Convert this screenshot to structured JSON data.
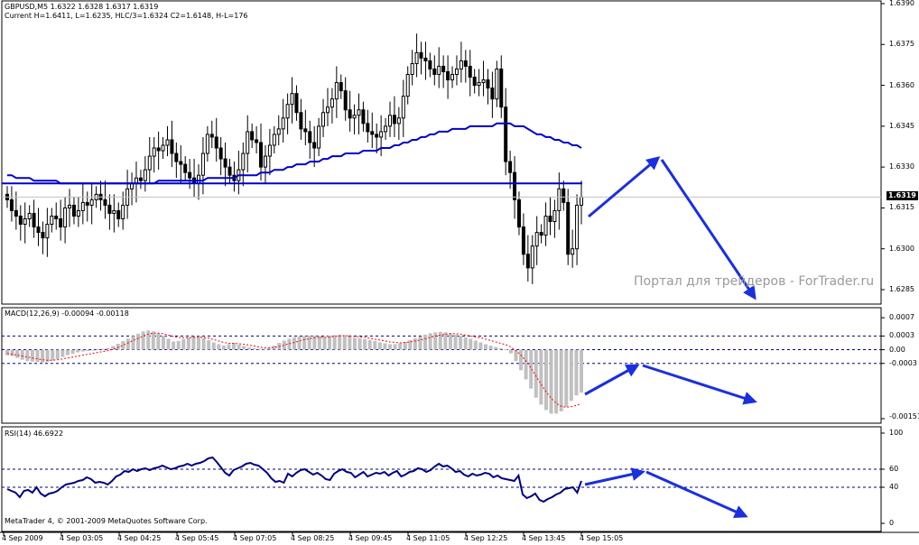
{
  "main_header": {
    "symbol_line": "GBPUSD,M5  1.6322 1.6328 1.6317 1.6319",
    "current_line": "Current H=1.6411, L=1.6235, HLC/3=1.6324 C2=1.6148, H-L=176"
  },
  "macd_header": "MACD(12,26,9) -0.00094 -0.00118",
  "rsi_header": "RSI(14) 46.6922",
  "copyright": "MetaTrader 4, © 2001-2009 MetaQuotes Software Corp.",
  "watermark": "Портал для трейдеров - ForTrader.ru",
  "current_price_tag": "1.6319",
  "price_axis_labels": [
    "1.6390",
    "1.6375",
    "1.6360",
    "1.6345",
    "1.6330",
    "1.6315",
    "1.6300",
    "1.6285"
  ],
  "macd_axis_labels": [
    "0.0007",
    "0.0003",
    "0.00",
    "-0.0003",
    "-0.00151"
  ],
  "rsi_axis_labels": [
    "100",
    "60",
    "40",
    "0"
  ],
  "time_axis_labels": [
    "4 Sep 2009",
    "4 Sep 03:05",
    "4 Sep 04:25",
    "4 Sep 05:45",
    "4 Sep 07:05",
    "4 Sep 08:25",
    "4 Sep 09:45",
    "4 Sep 11:05",
    "4 Sep 12:25",
    "4 Sep 13:45",
    "4 Sep 15:05"
  ],
  "colors": {
    "bull_candle": "#000000",
    "bear_candle": "#000000",
    "moving_average": "#0000cc",
    "horizontal_level": "#0000cc",
    "forecast_arrows": "#1a2fe0",
    "macd_histogram": "#c0c0c0",
    "macd_signal": "#ff0000",
    "rsi_line": "#000080",
    "level_lines": "#000080"
  },
  "chart_data": [
    {
      "type": "candlestick",
      "title": "GBPUSD,M5",
      "ylim": [
        1.6285,
        1.639
      ],
      "horizontal_level": 1.6324,
      "current_price": 1.6319,
      "closes": [
        1.6318,
        1.6314,
        1.6312,
        1.6309,
        1.6311,
        1.6313,
        1.6308,
        1.6306,
        1.6304,
        1.6309,
        1.6312,
        1.6311,
        1.6308,
        1.6315,
        1.6316,
        1.6312,
        1.6314,
        1.6317,
        1.6316,
        1.6318,
        1.632,
        1.6318,
        1.6316,
        1.6313,
        1.6314,
        1.6311,
        1.6316,
        1.6322,
        1.6324,
        1.6326,
        1.6325,
        1.6329,
        1.6334,
        1.6337,
        1.6336,
        1.6338,
        1.634,
        1.6335,
        1.6332,
        1.6331,
        1.6328,
        1.6326,
        1.6324,
        1.6327,
        1.6335,
        1.6342,
        1.6341,
        1.6337,
        1.6333,
        1.633,
        1.6327,
        1.6325,
        1.6329,
        1.6335,
        1.6343,
        1.634,
        1.6339,
        1.633,
        1.6334,
        1.6338,
        1.6342,
        1.6344,
        1.6348,
        1.6353,
        1.6357,
        1.635,
        1.6344,
        1.6343,
        1.6339,
        1.6337,
        1.6345,
        1.635,
        1.6352,
        1.6355,
        1.6361,
        1.6358,
        1.6351,
        1.6348,
        1.6349,
        1.6351,
        1.6346,
        1.6343,
        1.6342,
        1.6341,
        1.6343,
        1.6345,
        1.6349,
        1.6346,
        1.6348,
        1.6356,
        1.6364,
        1.6368,
        1.6372,
        1.637,
        1.6369,
        1.6366,
        1.6364,
        1.6367,
        1.6365,
        1.6362,
        1.6364,
        1.6366,
        1.6369,
        1.6367,
        1.6363,
        1.636,
        1.6361,
        1.6362,
        1.6359,
        1.6355,
        1.6366,
        1.6352,
        1.6332,
        1.6328,
        1.6318,
        1.6308,
        1.6298,
        1.6293,
        1.6301,
        1.6306,
        1.6305,
        1.6312,
        1.631,
        1.6314,
        1.6322,
        1.6317,
        1.6298,
        1.63,
        1.6316,
        1.6319
      ],
      "series": [
        {
          "name": "MA",
          "values": [
            1.6327,
            1.6327,
            1.6326,
            1.6326,
            1.6326,
            1.6326,
            1.6325,
            1.6325,
            1.6325,
            1.6325,
            1.6325,
            1.6325,
            1.6324,
            1.6324,
            1.6324,
            1.6324,
            1.6324,
            1.6324,
            1.6324,
            1.6324,
            1.6324,
            1.6324,
            1.6324,
            1.6324,
            1.6324,
            1.6324,
            1.6324,
            1.6324,
            1.6324,
            1.6324,
            1.6324,
            1.6324,
            1.6324,
            1.6324,
            1.6325,
            1.6325,
            1.6325,
            1.6325,
            1.6325,
            1.6325,
            1.6325,
            1.6325,
            1.6325,
            1.6325,
            1.6325,
            1.6326,
            1.6326,
            1.6326,
            1.6326,
            1.6326,
            1.6326,
            1.6326,
            1.6327,
            1.6327,
            1.6327,
            1.6327,
            1.6327,
            1.6328,
            1.6328,
            1.6328,
            1.6329,
            1.6329,
            1.6329,
            1.633,
            1.633,
            1.6331,
            1.6331,
            1.6331,
            1.6332,
            1.6332,
            1.6332,
            1.6333,
            1.6333,
            1.6334,
            1.6334,
            1.6334,
            1.6335,
            1.6335,
            1.6335,
            1.6335,
            1.6336,
            1.6336,
            1.6336,
            1.6336,
            1.6337,
            1.6337,
            1.6337,
            1.6338,
            1.6338,
            1.6339,
            1.6339,
            1.634,
            1.634,
            1.6341,
            1.6341,
            1.6342,
            1.6342,
            1.6343,
            1.6343,
            1.6343,
            1.6344,
            1.6344,
            1.6344,
            1.6344,
            1.6345,
            1.6345,
            1.6345,
            1.6345,
            1.6345,
            1.6345,
            1.6346,
            1.6346,
            1.6346,
            1.6346,
            1.6345,
            1.6345,
            1.6345,
            1.6344,
            1.6343,
            1.6342,
            1.6342,
            1.6341,
            1.6341,
            1.634,
            1.634,
            1.6339,
            1.6339,
            1.6338,
            1.6338,
            1.6337
          ]
        }
      ]
    },
    {
      "type": "bar",
      "title": "MACD(12,26,9)",
      "ylim": [
        -0.00151,
        0.0009
      ],
      "levels": [
        0.0003,
        0.0,
        -0.0003
      ],
      "series": [
        {
          "name": "MACD",
          "values": [
            -0.00012,
            -0.00014,
            -0.00018,
            -0.00022,
            -0.00025,
            -0.00026,
            -0.00027,
            -0.00028,
            -0.00027,
            -0.00024,
            -0.00021,
            -0.00016,
            -0.00012,
            -9e-05,
            -6e-05,
            -4e-05,
            -3e-05,
            -1e-05,
            1e-05,
            2e-05,
            4e-05,
            8e-05,
            0.00013,
            0.00019,
            0.00024,
            0.0003,
            0.00035,
            0.0004,
            0.00042,
            0.0004,
            0.00036,
            0.00031,
            0.00024,
            0.00018,
            0.00019,
            0.00023,
            0.00027,
            0.00029,
            0.0003,
            0.00026,
            0.00021,
            0.00016,
            0.00012,
            9e-05,
            0.00012,
            0.00015,
            0.00011,
            8e-05,
            5e-05,
            3e-05,
            2e-05,
            2e-05,
            4e-05,
            9e-05,
            0.00015,
            0.0002,
            0.00024,
            0.00027,
            0.00029,
            0.0003,
            0.00031,
            0.00031,
            0.0003,
            0.00028,
            0.00031,
            0.00032,
            0.00033,
            0.00032,
            0.00029,
            0.00026,
            0.00025,
            0.00023,
            0.00021,
            0.00019,
            0.00016,
            0.00014,
            0.00012,
            0.00012,
            0.00014,
            0.00017,
            0.00021,
            0.00025,
            0.00029,
            0.00033,
            0.00036,
            0.00038,
            0.00039,
            0.00038,
            0.00036,
            0.00033,
            0.0003,
            0.00027,
            0.00024,
            0.0002,
            0.00016,
            0.00012,
            9e-05,
            6e-05,
            3e-05,
            1e-05,
            -8e-05,
            -0.00025,
            -0.00045,
            -0.00065,
            -0.00085,
            -0.00105,
            -0.0012,
            -0.00132,
            -0.0014,
            -0.0014,
            -0.00135,
            -0.00125,
            -0.00112,
            -0.001,
            -0.00094
          ]
        },
        {
          "name": "Signal",
          "values": [
            -8e-05,
            -0.0001,
            -0.00012,
            -0.00014,
            -0.00016,
            -0.00018,
            -0.0002,
            -0.00022,
            -0.00023,
            -0.00023,
            -0.00022,
            -0.0002,
            -0.00018,
            -0.00016,
            -0.00014,
            -0.00012,
            -0.0001,
            -8e-05,
            -6e-05,
            -4e-05,
            -2e-05,
            1e-05,
            5e-05,
            0.0001,
            0.00015,
            0.0002,
            0.00025,
            0.0003,
            0.00034,
            0.00036,
            0.00036,
            0.00035,
            0.00032,
            0.00029,
            0.00027,
            0.00026,
            0.00026,
            0.00027,
            0.00028,
            0.00027,
            0.00025,
            0.00022,
            0.00019,
            0.00016,
            0.00014,
            0.00014,
            0.00013,
            0.00012,
            0.0001,
            8e-05,
            6e-05,
            4e-05,
            4e-05,
            5e-05,
            7e-05,
            0.0001,
            0.00013,
            0.00016,
            0.00019,
            0.00022,
            0.00024,
            0.00026,
            0.00027,
            0.00027,
            0.00028,
            0.00029,
            0.0003,
            0.00031,
            0.0003,
            0.00029,
            0.00028,
            0.00027,
            0.00025,
            0.00023,
            0.00021,
            0.00019,
            0.00017,
            0.00016,
            0.00015,
            0.00016,
            0.00017,
            0.00019,
            0.00021,
            0.00024,
            0.00027,
            0.0003,
            0.00032,
            0.00034,
            0.00035,
            0.00035,
            0.00034,
            0.00032,
            0.0003,
            0.00028,
            0.00026,
            0.00023,
            0.0002,
            0.00017,
            0.00014,
            0.00011,
            6e-05,
            -2e-05,
            -0.00012,
            -0.00025,
            -0.0004,
            -0.00058,
            -0.00076,
            -0.00092,
            -0.00106,
            -0.00117,
            -0.00124,
            -0.00126,
            -0.00125,
            -0.00122,
            -0.00118
          ]
        }
      ]
    },
    {
      "type": "line",
      "title": "RSI(14)",
      "ylim": [
        0,
        100
      ],
      "levels": [
        60,
        40
      ],
      "series": [
        {
          "name": "RSI",
          "values": [
            38,
            36,
            34,
            29,
            36,
            37,
            34,
            40,
            33,
            30,
            33,
            34,
            36,
            40,
            43,
            44,
            45,
            47,
            48,
            51,
            49,
            45,
            46,
            45,
            43,
            47,
            52,
            54,
            58,
            57,
            60,
            58,
            60,
            61,
            59,
            61,
            62,
            64,
            62,
            60,
            61,
            63,
            64,
            66,
            64,
            66,
            67,
            69,
            72,
            73,
            68,
            62,
            56,
            53,
            59,
            61,
            63,
            66,
            67,
            65,
            64,
            60,
            56,
            50,
            46,
            47,
            45,
            55,
            52,
            56,
            59,
            60,
            57,
            54,
            56,
            53,
            49,
            48,
            55,
            58,
            60,
            57,
            56,
            51,
            54,
            57,
            52,
            54,
            56,
            55,
            57,
            53,
            56,
            58,
            52,
            54,
            57,
            58,
            61,
            60,
            57,
            59,
            63,
            66,
            63,
            64,
            61,
            57,
            58,
            54,
            52,
            55,
            53,
            54,
            56,
            55,
            51,
            53,
            50,
            49,
            48,
            47,
            53,
            32,
            28,
            30,
            33,
            26,
            24,
            27,
            29,
            32,
            34,
            38,
            39,
            40,
            34,
            47
          ]
        }
      ]
    }
  ]
}
